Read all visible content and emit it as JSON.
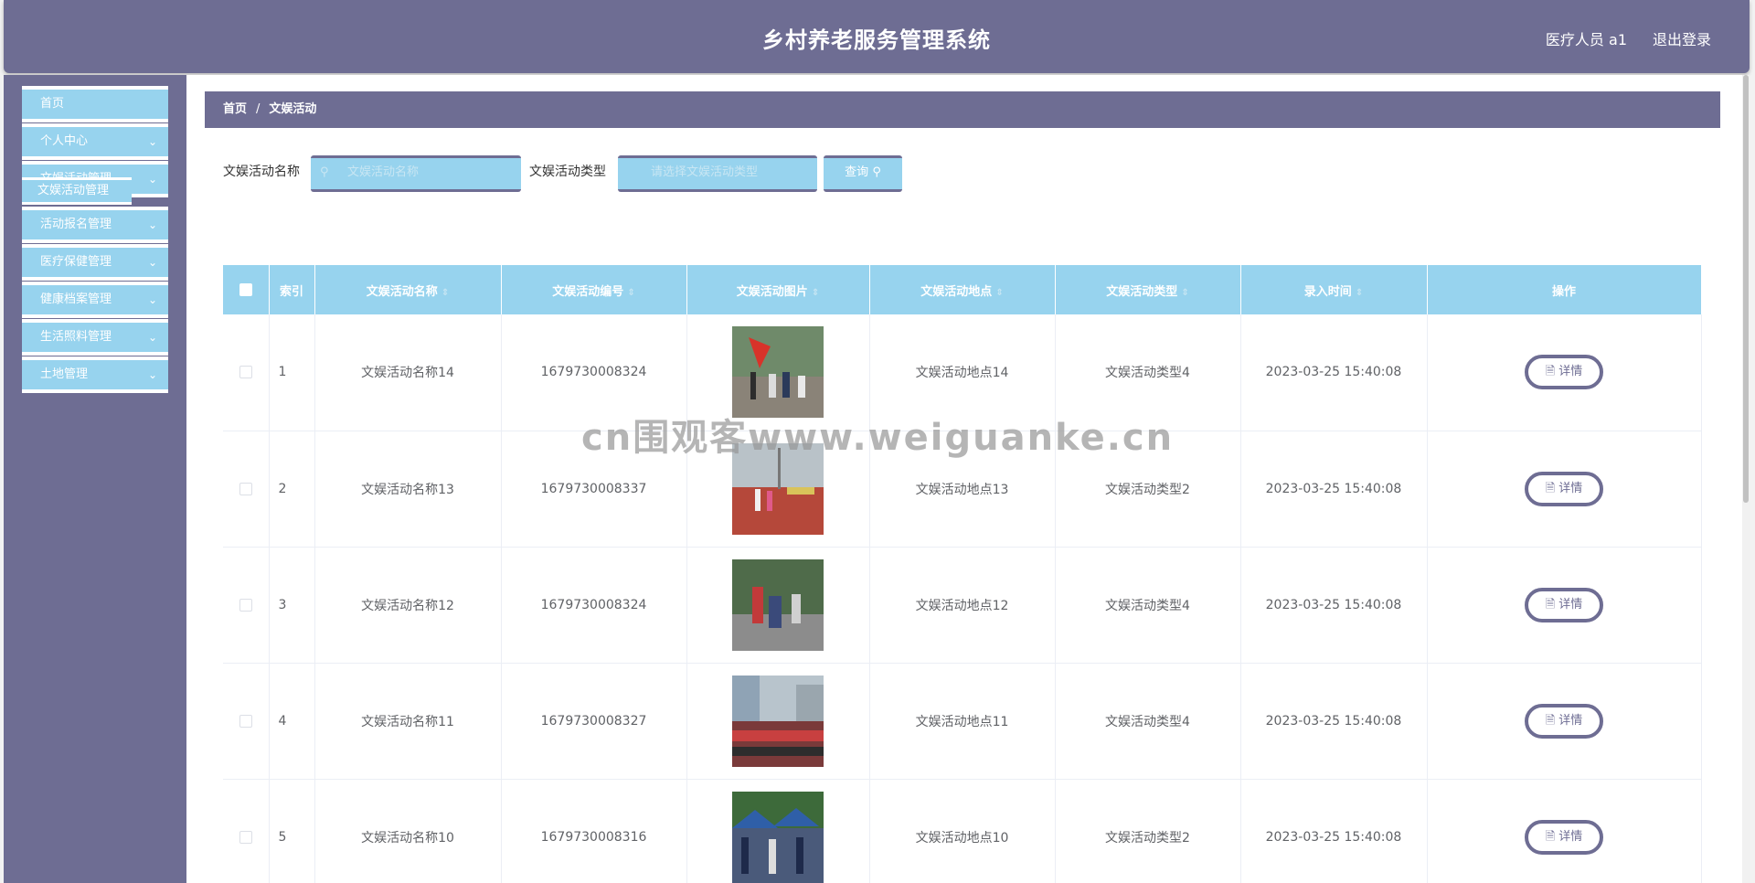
{
  "header": {
    "title": "乡村养老服务管理系统",
    "user": "医疗人员 a1",
    "logout": "退出登录"
  },
  "sidebar": {
    "items": [
      {
        "label": "首页",
        "chevron": false
      },
      {
        "label": "个人中心",
        "chevron": true
      },
      {
        "label": "文娱活动管理",
        "chevron": true
      },
      {
        "label": "活动报名管理",
        "chevron": true
      },
      {
        "label": "医疗保健管理",
        "chevron": true
      },
      {
        "label": "健康档案管理",
        "chevron": true
      },
      {
        "label": "生活照料管理",
        "chevron": true
      },
      {
        "label": "土地管理",
        "chevron": true
      }
    ],
    "submenu": {
      "label": "文娱活动管理"
    }
  },
  "breadcrumb": {
    "home": "首页",
    "current": "文娱活动"
  },
  "search": {
    "name_label": "文娱活动名称",
    "name_placeholder": "文娱活动名称",
    "type_label": "文娱活动类型",
    "type_placeholder": "请选择文娱活动类型",
    "query_label": "查询"
  },
  "table": {
    "headers": [
      "索引",
      "文娱活动名称",
      "文娱活动编号",
      "文娱活动图片",
      "文娱活动地点",
      "文娱活动类型",
      "录入时间",
      "操作"
    ],
    "rows": [
      {
        "index": "1",
        "name": "文娱活动名称14",
        "code": "1679730008324",
        "place": "文娱活动地点14",
        "type": "文娱活动类型4",
        "time": "2023-03-25 15:40:08",
        "action": "详情"
      },
      {
        "index": "2",
        "name": "文娱活动名称13",
        "code": "1679730008337",
        "place": "文娱活动地点13",
        "type": "文娱活动类型2",
        "time": "2023-03-25 15:40:08",
        "action": "详情"
      },
      {
        "index": "3",
        "name": "文娱活动名称12",
        "code": "1679730008324",
        "place": "文娱活动地点12",
        "type": "文娱活动类型4",
        "time": "2023-03-25 15:40:08",
        "action": "详情"
      },
      {
        "index": "4",
        "name": "文娱活动名称11",
        "code": "1679730008327",
        "place": "文娱活动地点11",
        "type": "文娱活动类型4",
        "time": "2023-03-25 15:40:08",
        "action": "详情"
      },
      {
        "index": "5",
        "name": "文娱活动名称10",
        "code": "1679730008316",
        "place": "文娱活动地点10",
        "type": "文娱活动类型2",
        "time": "2023-03-25 15:40:08",
        "action": "详情"
      }
    ]
  },
  "watermark": "cn围观客www.weiguanke.cn",
  "colors": {
    "primary": "#6e6d93",
    "accent": "#97d3ee"
  }
}
